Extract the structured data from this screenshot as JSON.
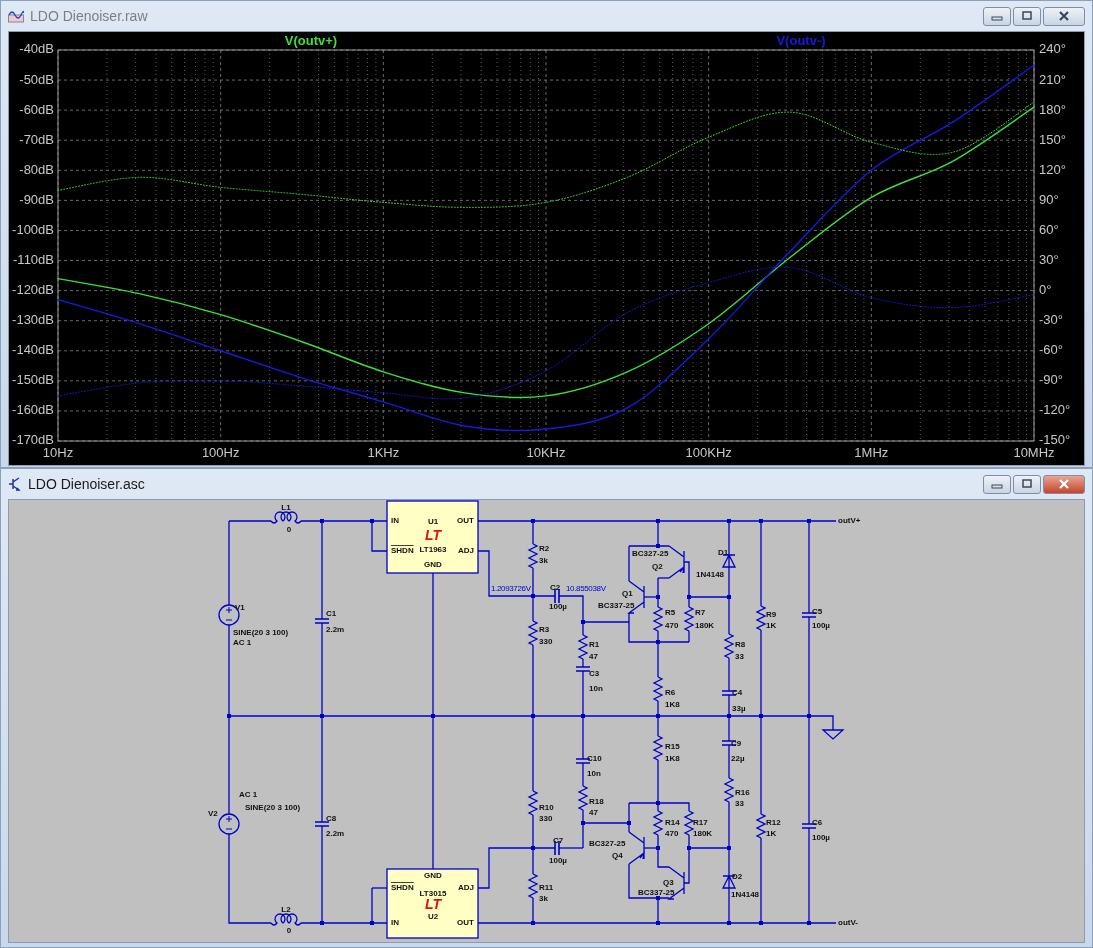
{
  "windows": [
    {
      "title": "LDO Dienoiser.raw",
      "active": false,
      "kind": "plot"
    },
    {
      "title": "LDO Dienoiser.asc",
      "active": true,
      "kind": "schematic"
    }
  ],
  "plot": {
    "chart_data": {
      "type": "line",
      "categories": [
        "10Hz",
        null,
        "100Hz",
        null,
        "1KHz",
        null,
        "10KHz",
        null,
        "100KHz",
        null,
        "1MHz",
        null,
        "10MHz"
      ],
      "grid": true,
      "ylim": [
        -170,
        -40
      ],
      "y2lim": [
        -150,
        240
      ],
      "yticks": [
        {
          "value": -40,
          "label": "-40dB"
        },
        {
          "value": -50,
          "label": "-50dB"
        },
        {
          "value": -60,
          "label": "-60dB"
        },
        {
          "value": -70,
          "label": "-70dB"
        },
        {
          "value": -80,
          "label": "-80dB"
        },
        {
          "value": -90,
          "label": "-90dB"
        },
        {
          "value": -100,
          "label": "-100dB"
        },
        {
          "value": -110,
          "label": "-110dB"
        },
        {
          "value": -120,
          "label": "-120dB"
        },
        {
          "value": -130,
          "label": "-130dB"
        },
        {
          "value": -140,
          "label": "-140dB"
        },
        {
          "value": -150,
          "label": "-150dB"
        },
        {
          "value": -160,
          "label": "-160dB"
        },
        {
          "value": -170,
          "label": "-170dB"
        }
      ],
      "y2ticks": [
        {
          "value": 240,
          "label": "240°"
        },
        {
          "value": 210,
          "label": "210°"
        },
        {
          "value": 180,
          "label": "180°"
        },
        {
          "value": 150,
          "label": "150°"
        },
        {
          "value": 120,
          "label": "120°"
        },
        {
          "value": 90,
          "label": "90°"
        },
        {
          "value": 60,
          "label": "60°"
        },
        {
          "value": 30,
          "label": "30°"
        },
        {
          "value": 0,
          "label": "0°"
        },
        {
          "value": -30,
          "label": "-30°"
        },
        {
          "value": -60,
          "label": "-60°"
        },
        {
          "value": -90,
          "label": "-90°"
        },
        {
          "value": -120,
          "label": "-120°"
        },
        {
          "value": -150,
          "label": "-150°"
        }
      ],
      "series": [
        {
          "name": "V(outv+)",
          "color": "#3ce03c",
          "values": [
            -116,
            -121,
            -128,
            -137,
            -147,
            -154,
            -155,
            -147,
            -131,
            -109,
            -89,
            -77,
            -59
          ]
        },
        {
          "name": "V(outv-)",
          "color": "#1818e0",
          "values": [
            -123,
            -131,
            -140,
            -149,
            -157,
            -165,
            -166,
            -159,
            -136,
            -107,
            -80,
            -64,
            -45
          ]
        },
        {
          "color": "#3ce03c",
          "axis": "y2",
          "line_style": "dotted",
          "values": [
            100,
            113,
            103,
            96,
            88,
            83,
            88,
            113,
            153,
            178,
            148,
            138,
            188
          ]
        },
        {
          "color": "#1818e0",
          "axis": "y2",
          "line_style": "dotted",
          "values": [
            -105,
            -92,
            -90,
            -95,
            -102,
            -107,
            -80,
            -22,
            8,
            23,
            -7,
            -17,
            -4
          ]
        }
      ]
    }
  },
  "schematic": {
    "components": [
      {
        "kind": "inductor",
        "ref": "L1",
        "values": [
          "0"
        ]
      },
      {
        "kind": "source",
        "ref": "V1",
        "values": [
          "SINE(20 3 100)",
          "AC 1"
        ]
      },
      {
        "kind": "capacitor",
        "ref": "C1",
        "values": [
          "2.2m"
        ]
      },
      {
        "kind": "resistor",
        "ref": "R2",
        "values": [
          "3k"
        ]
      },
      {
        "kind": "capacitor-h",
        "ref": "C2",
        "values": [
          "100µ"
        ]
      },
      {
        "kind": "resistor",
        "ref": "R3",
        "values": [
          "330"
        ]
      },
      {
        "kind": "resistor",
        "ref": "R1",
        "values": [
          "47"
        ]
      },
      {
        "kind": "capacitor",
        "ref": "C3",
        "values": [
          "10n"
        ]
      },
      {
        "kind": "npn",
        "ref": "Q1",
        "values": [
          "BC337-25"
        ]
      },
      {
        "kind": "pnp",
        "ref": "Q2",
        "values": [
          "BC327-25"
        ]
      },
      {
        "kind": "resistor",
        "ref": "R5",
        "values": [
          "470"
        ]
      },
      {
        "kind": "resistor",
        "ref": "R7",
        "values": [
          "180K"
        ]
      },
      {
        "kind": "resistor",
        "ref": "R6",
        "values": [
          "1K8"
        ]
      },
      {
        "kind": "diode",
        "ref": "D1",
        "values": [
          "1N4148"
        ]
      },
      {
        "kind": "resistor",
        "ref": "R8",
        "values": [
          "33"
        ]
      },
      {
        "kind": "capacitor",
        "ref": "C4",
        "values": [
          "33µ"
        ]
      },
      {
        "kind": "resistor",
        "ref": "R9",
        "values": [
          "1K"
        ]
      },
      {
        "kind": "capacitor",
        "ref": "C5",
        "values": [
          "100µ"
        ]
      },
      {
        "kind": "source",
        "ref": "V2",
        "values": [
          "AC 1",
          "SINE(20 3 100)"
        ]
      },
      {
        "kind": "capacitor",
        "ref": "C8",
        "values": [
          "2.2m"
        ]
      },
      {
        "kind": "capacitor",
        "ref": "C10",
        "values": [
          "10n"
        ]
      },
      {
        "kind": "resistor",
        "ref": "R10",
        "values": [
          "330"
        ]
      },
      {
        "kind": "resistor",
        "ref": "R18",
        "values": [
          "47"
        ]
      },
      {
        "kind": "capacitor-h",
        "ref": "C7",
        "values": [
          "100µ"
        ]
      },
      {
        "kind": "resistor",
        "ref": "R11",
        "values": [
          "3k"
        ]
      },
      {
        "kind": "resistor",
        "ref": "R15",
        "values": [
          "1K8"
        ]
      },
      {
        "kind": "resistor",
        "ref": "R14",
        "values": [
          "470"
        ]
      },
      {
        "kind": "resistor",
        "ref": "R17",
        "values": [
          "180K"
        ]
      },
      {
        "kind": "pnp",
        "ref": "Q4",
        "values": [
          "BC327-25"
        ]
      },
      {
        "kind": "npn",
        "ref": "Q3",
        "values": [
          "BC337-25"
        ]
      },
      {
        "kind": "capacitor",
        "ref": "C9",
        "values": [
          "22µ"
        ]
      },
      {
        "kind": "resistor",
        "ref": "R16",
        "values": [
          "33"
        ]
      },
      {
        "kind": "diode",
        "ref": "D2",
        "values": [
          "1N4148"
        ]
      },
      {
        "kind": "resistor",
        "ref": "R12",
        "values": [
          "1K"
        ]
      },
      {
        "kind": "capacitor",
        "ref": "C6",
        "values": [
          "100µ"
        ]
      },
      {
        "kind": "inductor",
        "ref": "L2",
        "values": [
          "0"
        ]
      }
    ],
    "chips": [
      {
        "ref": "U1",
        "part": "LT1963",
        "logo": "LT",
        "pins": [
          {
            "label": "IN",
            "inverted": false
          },
          {
            "label": "SHDN",
            "inverted": true
          },
          {
            "label": "OUT",
            "inverted": false
          },
          {
            "label": "ADJ",
            "inverted": false
          },
          {
            "label": "GND",
            "inverted": false
          }
        ]
      },
      {
        "ref": "U2",
        "part": "LT3015",
        "logo": "LT",
        "pins": [
          {
            "label": "GND",
            "inverted": false
          },
          {
            "label": "SHDN",
            "inverted": true
          },
          {
            "label": "IN",
            "inverted": false
          },
          {
            "label": "ADJ",
            "inverted": false
          },
          {
            "label": "OUT",
            "inverted": false
          }
        ]
      }
    ],
    "voltages": [
      "1.2093726V",
      "10.855038V"
    ],
    "ports": [
      "outV+",
      "outV-"
    ]
  }
}
